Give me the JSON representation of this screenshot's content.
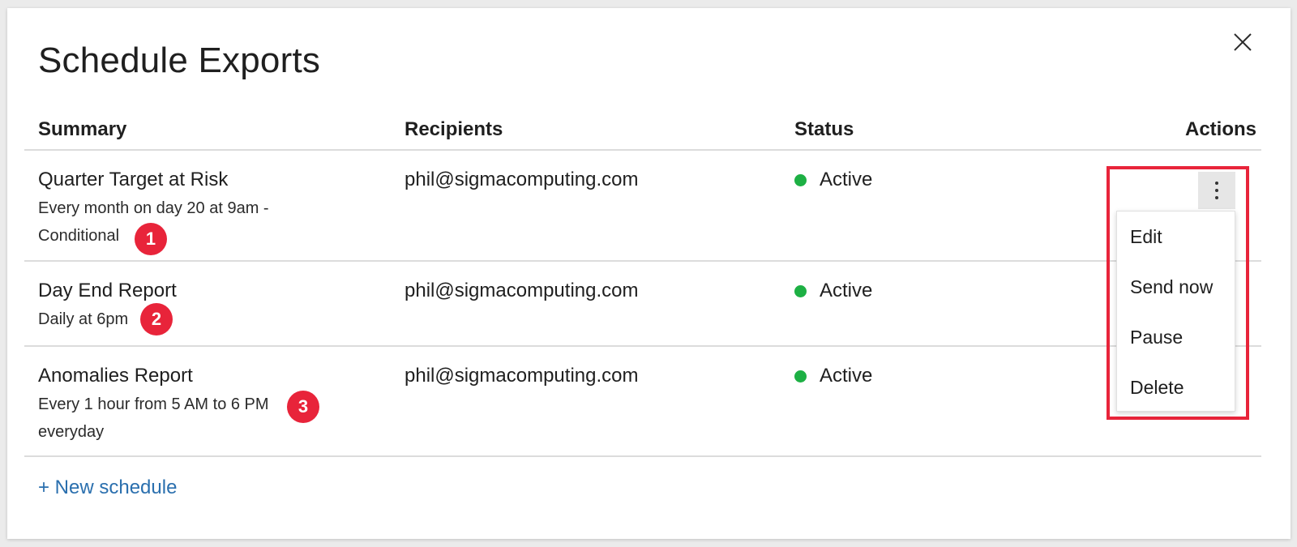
{
  "dialog": {
    "title": "Schedule Exports",
    "close_icon": "close-icon"
  },
  "table": {
    "columns": [
      "Summary",
      "Recipients",
      "Status",
      "Actions"
    ],
    "rows": [
      {
        "title": "Quarter Target at Risk",
        "sub_lines": [
          "Every month on day 20 at 9am -",
          "Conditional"
        ],
        "recipient": "phil@sigmacomputing.com",
        "status": "Active",
        "badge": "1"
      },
      {
        "title": "Day End Report",
        "sub_lines": [
          "Daily at 6pm"
        ],
        "recipient": "phil@sigmacomputing.com",
        "status": "Active",
        "badge": "2"
      },
      {
        "title": "Anomalies Report",
        "sub_lines": [
          "Every 1 hour from 5 AM to 6 PM",
          "everyday"
        ],
        "recipient": "phil@sigmacomputing.com",
        "status": "Active",
        "badge": "3"
      }
    ]
  },
  "actions_menu": {
    "trigger_icon": "more-vertical-icon",
    "items": [
      "Edit",
      "Send now",
      "Pause",
      "Delete"
    ]
  },
  "footer": {
    "new_schedule_label": "+ New schedule"
  },
  "colors": {
    "status_active": "#1db044",
    "badge": "#e8243a",
    "highlight_border": "#e8243a",
    "link": "#2a6fae"
  }
}
